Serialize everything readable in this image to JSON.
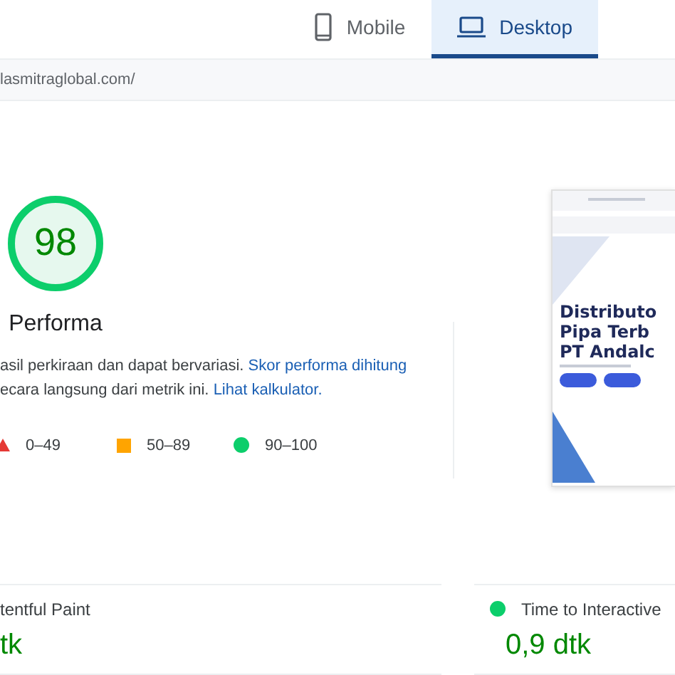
{
  "tabs": [
    {
      "label": "Mobile",
      "selected": false
    },
    {
      "label": "Desktop",
      "selected": true
    }
  ],
  "url": "lasmitraglobal.com/",
  "score": {
    "value": "98",
    "label": "Performa"
  },
  "note": [
    {
      "text": "asil perkiraan dan dapat bervariasi.",
      "link": "Skor performa dihitung"
    },
    {
      "text": "ecara langsung dari metrik ini.",
      "link": "Lihat kalkulator."
    }
  ],
  "legend": [
    {
      "kind": "triangle",
      "label": "0–49",
      "color": "#e53935"
    },
    {
      "kind": "square",
      "label": "50–89",
      "color": "#ffa400"
    },
    {
      "kind": "circle",
      "label": "90–100",
      "color": "#0cce6b"
    }
  ],
  "preview": {
    "headline": [
      "Distributo",
      "Pipa Terb",
      "PT Andalc"
    ]
  },
  "metrics": [
    {
      "label": "tentful Paint",
      "value": "tk"
    },
    {
      "label": "Time to Interactive",
      "value": "0,9 dtk"
    }
  ]
}
